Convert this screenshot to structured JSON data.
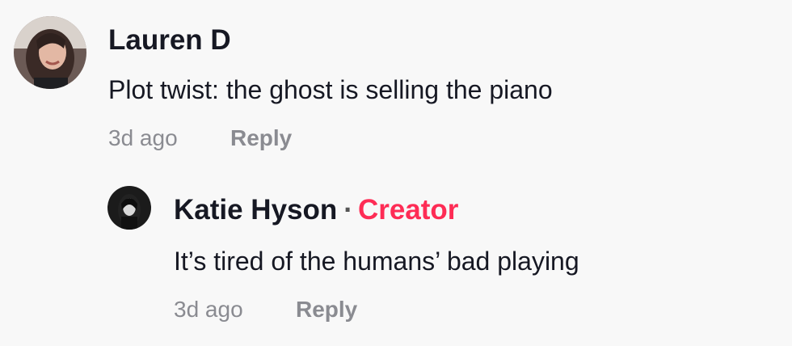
{
  "comments": [
    {
      "author": "Lauren D",
      "text": "Plot twist: the ghost is selling the piano",
      "time": "3d ago",
      "reply_label": "Reply",
      "avatar_icon": "user-avatar-lauren"
    }
  ],
  "replies": [
    {
      "author": "Katie Hyson",
      "separator": "·",
      "badge": "Creator",
      "text": "It’s tired of the humans’ bad playing",
      "time": "3d ago",
      "reply_label": "Reply",
      "avatar_icon": "user-avatar-katie"
    }
  ],
  "colors": {
    "background": "#f8f8f8",
    "text_primary": "#161823",
    "text_secondary": "#8a8b91",
    "creator_badge": "#fe2c55"
  }
}
